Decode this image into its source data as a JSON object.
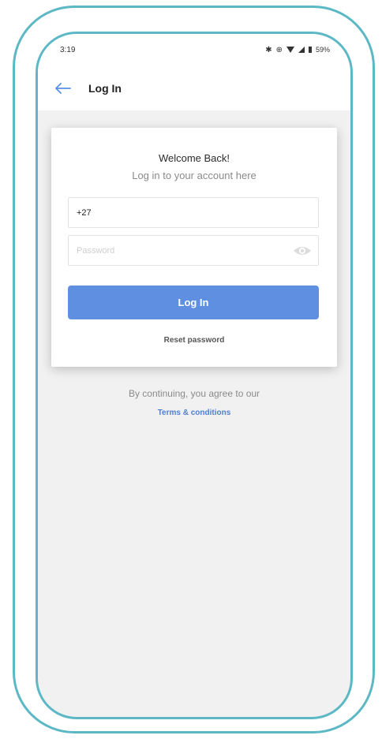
{
  "status_bar": {
    "time": "3:19",
    "battery_pct": "59%",
    "icons": [
      "bluetooth-icon",
      "sync-icon",
      "wifi-icon",
      "signal-icon",
      "battery-icon"
    ]
  },
  "app_bar": {
    "title": "Log In",
    "back_icon": "arrow-left-icon"
  },
  "login_card": {
    "welcome": "Welcome Back!",
    "subtitle": "Log in to your account here",
    "phone_value": "+27",
    "password_placeholder": "Password",
    "password_toggle_icon": "eye-icon",
    "login_button": "Log In",
    "reset_password": "Reset password"
  },
  "footer": {
    "agree_text": "By continuing, you agree to our",
    "terms_link": "Terms & conditions"
  },
  "colors": {
    "accent": "#5e8fe0",
    "frame": "#5bb8c4",
    "background": "#f1f1f1",
    "link": "#4f7fcf"
  }
}
